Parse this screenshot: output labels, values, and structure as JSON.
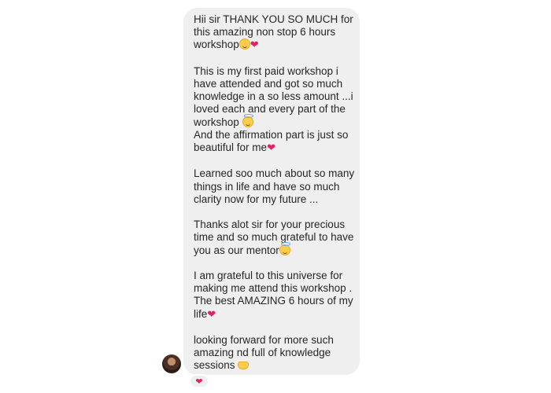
{
  "message": {
    "paragraphs": [
      {
        "lines": [
          "Hii sir THANK YOU SO MUCH for",
          "this amazing non stop 6 hours",
          "workshop"
        ],
        "trailing_emoji": [
          "pleading-face",
          "red-heart"
        ]
      },
      {
        "lines": [
          "This is my first paid workshop i",
          "have attended and got so much",
          "knowledge in a so less amount ...i",
          "loved each and every part of the",
          "workshop "
        ],
        "after_emoji_lines": [
          "And the affirmation part is just so",
          "beautiful for me"
        ]
      },
      {
        "lines": [
          "Learned soo much about so many",
          "things in life and have so much",
          "clarity now for my future ..."
        ]
      },
      {
        "lines": [
          "Thanks alot sir for your precious",
          "time and so much grateful to have",
          "you as our mentor"
        ]
      },
      {
        "lines": [
          "I am grateful to this universe for",
          "making me attend this workshop .",
          "The best AMAZING 6 hours of my",
          "life"
        ]
      },
      {
        "lines": [
          "looking forward for more such",
          "amazing nd full of knowledge",
          "sessions "
        ]
      }
    ],
    "heart_glyph": "❤",
    "reaction": "❤"
  },
  "colors": {
    "bubble": "#efefef",
    "text": "#262626",
    "heart": "#e0245e"
  }
}
